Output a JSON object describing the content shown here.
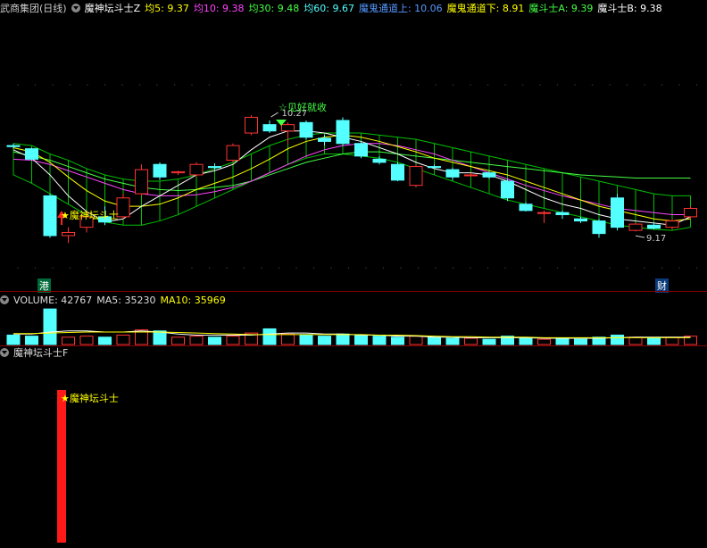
{
  "header": {
    "title": "武商集团(日线)",
    "indicator": "魔神坛斗士Z",
    "ma5": "均5: 9.37",
    "ma10": "均10: 9.38",
    "ma30": "均30: 9.48",
    "ma60": "均60: 9.67",
    "upper": "魔鬼通道上: 10.06",
    "lower": "魔鬼通道下: 8.91",
    "msa": "魔斗士A: 9.39",
    "msb": "魔斗士B: 9.38"
  },
  "volume_header": {
    "label": "VOLUME: 42767",
    "ma5": "MA5: 35230",
    "ma10": "MA10: 35969"
  },
  "sub_header": {
    "title": "魔神坛斗士F"
  },
  "annotations": {
    "signal_buy": "魔神坛斗士",
    "signal_sell": "☆见好就收",
    "high_label": "10.27",
    "low_label": "9.17",
    "tag_hk": "港",
    "tag_fin": "财",
    "sub_signal": "魔神坛斗士"
  },
  "colors": {
    "up": "#ff3333",
    "down": "#54ffff",
    "ma5": "#ffffff",
    "ma10": "#ffff00",
    "ma30": "#ff44ff",
    "ma60": "#44ff44",
    "channel": "#00c000",
    "separator": "#8a0000"
  },
  "chart_data": {
    "type": "candlestick",
    "ylim": [
      8.6,
      11.2
    ],
    "candles": [
      {
        "o": 9.98,
        "h": 10.0,
        "l": 9.95,
        "c": 9.97
      },
      {
        "o": 9.95,
        "h": 9.96,
        "l": 9.84,
        "c": 9.85
      },
      {
        "o": 9.5,
        "h": 9.52,
        "l": 9.1,
        "c": 9.12
      },
      {
        "o": 9.12,
        "h": 9.2,
        "l": 9.05,
        "c": 9.15
      },
      {
        "o": 9.2,
        "h": 9.35,
        "l": 9.15,
        "c": 9.3
      },
      {
        "o": 9.3,
        "h": 9.4,
        "l": 9.22,
        "c": 9.25
      },
      {
        "o": 9.3,
        "h": 9.52,
        "l": 9.28,
        "c": 9.48
      },
      {
        "o": 9.52,
        "h": 9.8,
        "l": 9.5,
        "c": 9.75
      },
      {
        "o": 9.8,
        "h": 9.82,
        "l": 9.65,
        "c": 9.68
      },
      {
        "o": 9.72,
        "h": 9.74,
        "l": 9.7,
        "c": 9.73
      },
      {
        "o": 9.7,
        "h": 9.82,
        "l": 9.68,
        "c": 9.8
      },
      {
        "o": 9.78,
        "h": 9.81,
        "l": 9.75,
        "c": 9.77
      },
      {
        "o": 9.84,
        "h": 10.0,
        "l": 9.82,
        "c": 9.98
      },
      {
        "o": 10.1,
        "h": 10.27,
        "l": 10.08,
        "c": 10.25
      },
      {
        "o": 10.18,
        "h": 10.22,
        "l": 10.1,
        "c": 10.12
      },
      {
        "o": 10.12,
        "h": 10.2,
        "l": 10.0,
        "c": 10.18
      },
      {
        "o": 10.2,
        "h": 10.22,
        "l": 10.04,
        "c": 10.06
      },
      {
        "o": 10.05,
        "h": 10.08,
        "l": 9.98,
        "c": 10.02
      },
      {
        "o": 10.22,
        "h": 10.25,
        "l": 9.98,
        "c": 10.0
      },
      {
        "o": 10.0,
        "h": 10.02,
        "l": 9.86,
        "c": 9.88
      },
      {
        "o": 9.85,
        "h": 9.88,
        "l": 9.8,
        "c": 9.82
      },
      {
        "o": 9.8,
        "h": 9.82,
        "l": 9.64,
        "c": 9.65
      },
      {
        "o": 9.6,
        "h": 9.8,
        "l": 9.58,
        "c": 9.78
      },
      {
        "o": 9.78,
        "h": 9.8,
        "l": 9.76,
        "c": 9.77
      },
      {
        "o": 9.75,
        "h": 9.77,
        "l": 9.65,
        "c": 9.68
      },
      {
        "o": 9.7,
        "h": 9.72,
        "l": 9.68,
        "c": 9.7
      },
      {
        "o": 9.72,
        "h": 9.74,
        "l": 9.66,
        "c": 9.68
      },
      {
        "o": 9.64,
        "h": 9.66,
        "l": 9.45,
        "c": 9.48
      },
      {
        "o": 9.42,
        "h": 9.44,
        "l": 9.35,
        "c": 9.36
      },
      {
        "o": 9.34,
        "h": 9.36,
        "l": 9.24,
        "c": 9.34
      },
      {
        "o": 9.34,
        "h": 9.36,
        "l": 9.28,
        "c": 9.32
      },
      {
        "o": 9.28,
        "h": 9.3,
        "l": 9.24,
        "c": 9.26
      },
      {
        "o": 9.26,
        "h": 9.28,
        "l": 9.1,
        "c": 9.14
      },
      {
        "o": 9.48,
        "h": 9.52,
        "l": 9.17,
        "c": 9.2
      },
      {
        "o": 9.17,
        "h": 9.24,
        "l": 9.16,
        "c": 9.23
      },
      {
        "o": 9.22,
        "h": 9.24,
        "l": 9.18,
        "c": 9.19
      },
      {
        "o": 9.2,
        "h": 9.28,
        "l": 9.18,
        "c": 9.26
      },
      {
        "o": 9.3,
        "h": 9.4,
        "l": 9.28,
        "c": 9.38
      }
    ],
    "ma5": [
      9.94,
      9.86,
      9.7,
      9.5,
      9.35,
      9.25,
      9.28,
      9.4,
      9.5,
      9.6,
      9.7,
      9.74,
      9.8,
      9.94,
      10.06,
      10.12,
      10.12,
      10.1,
      10.06,
      10.02,
      9.96,
      9.9,
      9.82,
      9.76,
      9.72,
      9.72,
      9.7,
      9.64,
      9.56,
      9.48,
      9.42,
      9.38,
      9.32,
      9.28,
      9.26,
      9.24,
      9.22,
      9.3
    ],
    "ma10": [
      9.96,
      9.92,
      9.82,
      9.68,
      9.55,
      9.45,
      9.4,
      9.4,
      9.42,
      9.48,
      9.56,
      9.62,
      9.68,
      9.76,
      9.85,
      9.95,
      10.02,
      10.06,
      10.08,
      10.06,
      10.02,
      9.97,
      9.92,
      9.86,
      9.82,
      9.78,
      9.74,
      9.7,
      9.64,
      9.58,
      9.52,
      9.46,
      9.4,
      9.36,
      9.32,
      9.28,
      9.26,
      9.28
    ],
    "ma30": [
      9.85,
      9.84,
      9.8,
      9.74,
      9.68,
      9.62,
      9.56,
      9.52,
      9.5,
      9.5,
      9.51,
      9.54,
      9.58,
      9.64,
      9.72,
      9.8,
      9.88,
      9.94,
      9.98,
      10.0,
      10.0,
      9.98,
      9.94,
      9.9,
      9.84,
      9.78,
      9.72,
      9.66,
      9.6,
      9.55,
      9.5,
      9.46,
      9.42,
      9.38,
      9.36,
      9.34,
      9.32,
      9.32
    ],
    "ma60": [
      9.92,
      9.88,
      9.84,
      9.78,
      9.72,
      9.66,
      9.62,
      9.58,
      9.56,
      9.55,
      9.56,
      9.58,
      9.6,
      9.64,
      9.7,
      9.76,
      9.82,
      9.86,
      9.9,
      9.92,
      9.92,
      9.9,
      9.88,
      9.86,
      9.84,
      9.82,
      9.8,
      9.78,
      9.76,
      9.74,
      9.72,
      9.7,
      9.69,
      9.68,
      9.67,
      9.67,
      9.67,
      9.67
    ],
    "channel_upper": [
      10.0,
      9.98,
      9.9,
      9.84,
      9.76,
      9.7,
      9.66,
      9.64,
      9.64,
      9.66,
      9.7,
      9.76,
      9.82,
      9.9,
      9.98,
      10.04,
      10.08,
      10.1,
      10.1,
      10.1,
      10.08,
      10.06,
      10.04,
      10.0,
      9.96,
      9.92,
      9.88,
      9.84,
      9.8,
      9.76,
      9.72,
      9.68,
      9.64,
      9.6,
      9.56,
      9.52,
      9.5,
      9.5
    ],
    "channel_lower": [
      9.7,
      9.62,
      9.52,
      9.42,
      9.32,
      9.25,
      9.22,
      9.22,
      9.26,
      9.32,
      9.4,
      9.48,
      9.56,
      9.64,
      9.72,
      9.8,
      9.86,
      9.9,
      9.9,
      9.88,
      9.86,
      9.82,
      9.76,
      9.7,
      9.64,
      9.58,
      9.52,
      9.46,
      9.42,
      9.38,
      9.34,
      9.3,
      9.26,
      9.22,
      9.2,
      9.18,
      9.17,
      9.2
    ],
    "volume": [
      18,
      16,
      68,
      14,
      16,
      14,
      18,
      28,
      26,
      14,
      16,
      14,
      16,
      22,
      30,
      20,
      18,
      16,
      20,
      18,
      16,
      14,
      16,
      14,
      12,
      12,
      10,
      16,
      12,
      10,
      12,
      10,
      14,
      18,
      14,
      12,
      14,
      16
    ],
    "vol_ma5": [
      20,
      20,
      24,
      26,
      26,
      24,
      24,
      26,
      24,
      20,
      18,
      18,
      18,
      18,
      20,
      22,
      22,
      20,
      20,
      18,
      18,
      16,
      16,
      14,
      14,
      13,
      13,
      13,
      13,
      12,
      12,
      12,
      12,
      13,
      14,
      14,
      14,
      14
    ],
    "vol_ma10": [
      21,
      21,
      22,
      23,
      24,
      24,
      24,
      24,
      24,
      23,
      22,
      21,
      20,
      19,
      19,
      19,
      19,
      19,
      19,
      19,
      18,
      18,
      17,
      16,
      15,
      15,
      14,
      14,
      14,
      13,
      13,
      13,
      13,
      13,
      13,
      13,
      13,
      13
    ],
    "sub_value": 1
  }
}
